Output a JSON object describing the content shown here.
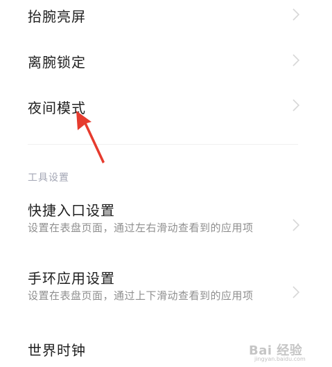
{
  "settings": {
    "items": [
      {
        "title": "抬腕亮屏"
      },
      {
        "title": "离腕锁定"
      },
      {
        "title": "夜间模式"
      }
    ],
    "section_label": "工具设置",
    "tool_items": [
      {
        "title": "快捷入口设置",
        "subtitle": "设置在表盘页面，通过左右滑动查看到的应用项"
      },
      {
        "title": "手环应用设置",
        "subtitle": "设置在表盘页面，通过上下滑动查看到的应用项"
      },
      {
        "title": "世界时钟"
      }
    ]
  },
  "annotation": {
    "arrow_color": "#e63b2e"
  },
  "watermark": {
    "text": "Bai 经验",
    "sub": "jingyan.baidu.com"
  }
}
